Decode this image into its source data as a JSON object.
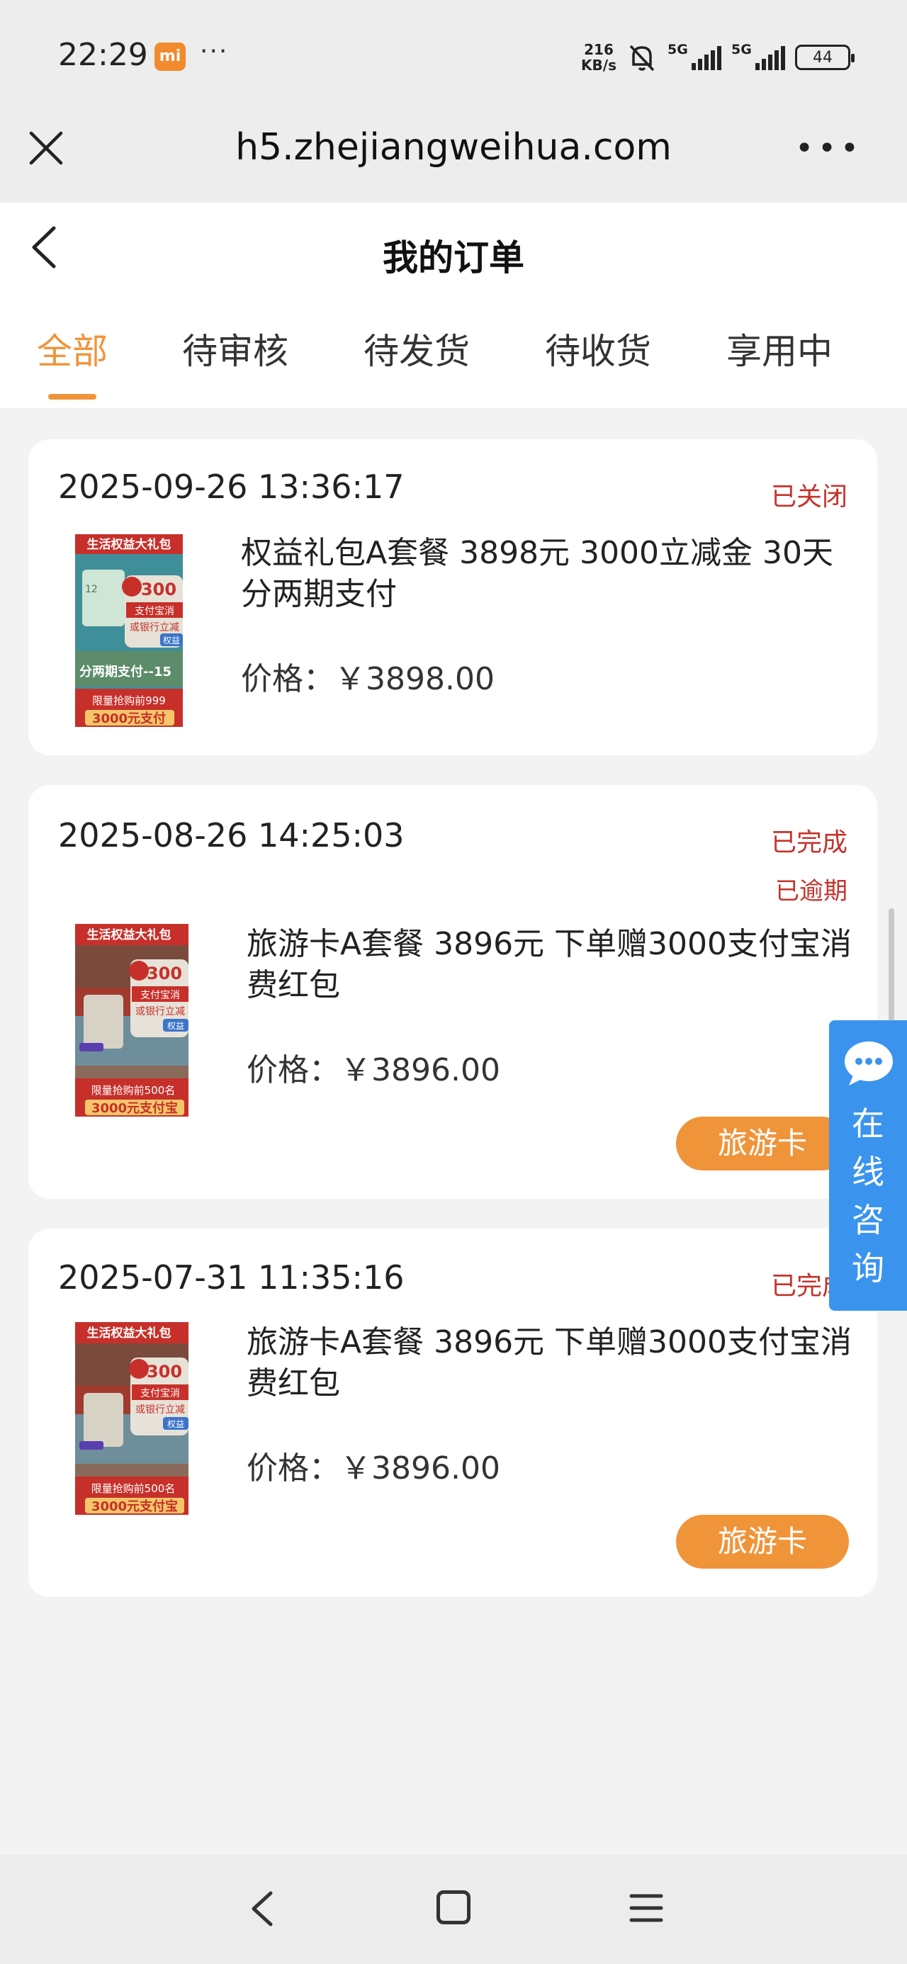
{
  "status_bar": {
    "time": "22:29",
    "mi_badge": "mi",
    "dots": "···",
    "net_speed_value": "216",
    "net_speed_unit": "KB/s",
    "sim1_label": "5G",
    "sim2_label": "5G",
    "battery": "44"
  },
  "browser": {
    "url": "h5.zhejiangweihua.com"
  },
  "header": {
    "title": "我的订单"
  },
  "tabs": [
    {
      "label": "全部",
      "active": true
    },
    {
      "label": "待审核"
    },
    {
      "label": "待发货"
    },
    {
      "label": "待收货"
    },
    {
      "label": "享用中"
    }
  ],
  "orders": [
    {
      "time": "2025-09-26 13:36:17",
      "status": "已关闭",
      "name": "权益礼包A套餐 3898元 3000立减金 30天分两期支付",
      "price": "价格：￥3898.00",
      "thumb": {
        "banner": "生活权益大礼包",
        "amount": "300",
        "line1": "支付宝消",
        "line2": "或银行立减",
        "tag": "权益",
        "period": "分两期支付--15",
        "limit": "限量抢购前999",
        "bottom": "3000元支付"
      }
    },
    {
      "time": "2025-08-26 14:25:03",
      "status": "已完成",
      "sub_status": "已逾期",
      "name": "旅游卡A套餐 3896元 下单赠3000支付宝消费红包",
      "price": "价格：￥3896.00",
      "button": "旅游卡",
      "thumb": {
        "banner": "生活权益大礼包",
        "amount": "300",
        "line1": "支付宝消",
        "line2": "或银行立减",
        "tag": "权益",
        "limit": "限量抢购前500名",
        "bottom": "3000元支付宝"
      }
    },
    {
      "time": "2025-07-31 11:35:16",
      "status": "已完成",
      "name": "旅游卡A套餐 3896元 下单赠3000支付宝消费红包",
      "price": "价格：￥3896.00",
      "button": "旅游卡",
      "thumb": {
        "banner": "生活权益大礼包",
        "amount": "300",
        "line1": "支付宝消",
        "line2": "或银行立减",
        "tag": "权益",
        "limit": "限量抢购前500名",
        "bottom": "3000元支付宝"
      }
    }
  ],
  "consult": {
    "label_1": "在",
    "label_2": "线",
    "label_3": "咨",
    "label_4": "询"
  },
  "colors": {
    "accent": "#f0943a",
    "status_red": "#c4332c",
    "consult_blue": "#3a94ee"
  }
}
